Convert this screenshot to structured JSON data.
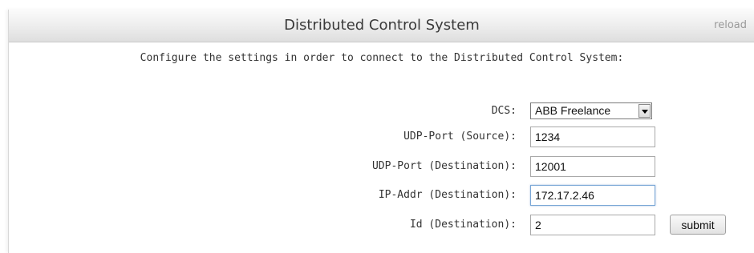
{
  "header": {
    "title": "Distributed Control System",
    "reload_label": "reload"
  },
  "instructions": "Configure the settings in order to connect to the Distributed Control System:",
  "form": {
    "dcs": {
      "label": "DCS:",
      "selected": "ABB Freelance"
    },
    "udp_port_source": {
      "label": "UDP-Port (Source):",
      "value": "1234"
    },
    "udp_port_destination": {
      "label": "UDP-Port (Destination):",
      "value": "12001"
    },
    "ip_addr_destination": {
      "label": "IP-Addr (Destination):",
      "value": "172.17.2.46"
    },
    "id_destination": {
      "label": "Id (Destination):",
      "value": "2"
    },
    "submit_label": "submit"
  },
  "icons": {
    "dropdown": "chevron-down-icon"
  }
}
